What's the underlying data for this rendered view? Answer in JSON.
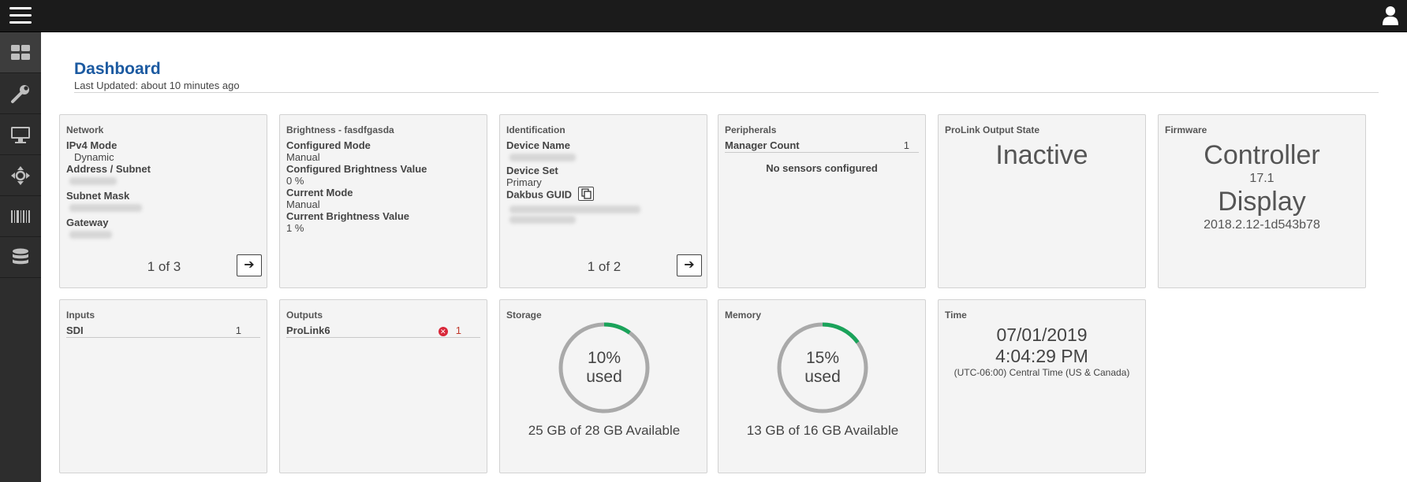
{
  "header": {
    "title": "Dashboard",
    "subtitle": "Last Updated: about 10 minutes ago"
  },
  "icons": {
    "menu": "hamburger-icon",
    "user": "user-icon",
    "sidebar": [
      "dashboard-icon",
      "wrench-icon",
      "monitor-icon",
      "move-icon",
      "barcode-icon",
      "database-icon"
    ]
  },
  "colors": {
    "accent": "#1c5aa1",
    "progress": "#1aa35a",
    "track": "#a9a9a9",
    "error": "#d9283a"
  },
  "network": {
    "title": "Network",
    "ipv4_label": "IPv4 Mode",
    "ipv4_value": "Dynamic",
    "address_label": "Address / Subnet",
    "mask_label": "Subnet Mask",
    "gateway_label": "Gateway",
    "pager": "1 of 3",
    "next": "➔"
  },
  "brightness": {
    "title": "Brightness - fasdfgasda",
    "configured_mode_label": "Configured Mode",
    "configured_mode_value": "Manual",
    "configured_value_label": "Configured Brightness Value",
    "configured_value": "0 %",
    "current_mode_label": "Current Mode",
    "current_mode_value": "Manual",
    "current_value_label": "Current Brightness Value",
    "current_value": "1 %"
  },
  "identification": {
    "title": "Identification",
    "device_name_label": "Device Name",
    "device_set_label": "Device Set",
    "device_set_value": "Primary",
    "guid_label": "Dakbus GUID",
    "pager": "1 of 2",
    "next": "➔"
  },
  "peripherals": {
    "title": "Peripherals",
    "manager_label": "Manager Count",
    "manager_count": "1",
    "message": "No sensors configured"
  },
  "prolink": {
    "title": "ProLink Output State",
    "state": "Inactive"
  },
  "firmware": {
    "title": "Firmware",
    "controller_label": "Controller",
    "controller_version": "17.1",
    "display_label": "Display",
    "display_version": "2018.2.12-1d543b78"
  },
  "inputs": {
    "title": "Inputs",
    "items": [
      {
        "name": "SDI",
        "count": "1"
      }
    ]
  },
  "outputs": {
    "title": "Outputs",
    "items": [
      {
        "name": "ProLink6",
        "count": "1"
      }
    ]
  },
  "storage": {
    "title": "Storage",
    "used_pct": "10%",
    "used_word": "used",
    "used_fraction": 0.1,
    "available": "25 GB of 28 GB Available"
  },
  "memory": {
    "title": "Memory",
    "used_pct": "15%",
    "used_word": "used",
    "used_fraction": 0.15,
    "available": "13 GB of 16 GB Available"
  },
  "time": {
    "title": "Time",
    "date": "07/01/2019",
    "clock": "4:04:29 PM",
    "zone": "(UTC-06:00) Central Time (US & Canada)"
  }
}
